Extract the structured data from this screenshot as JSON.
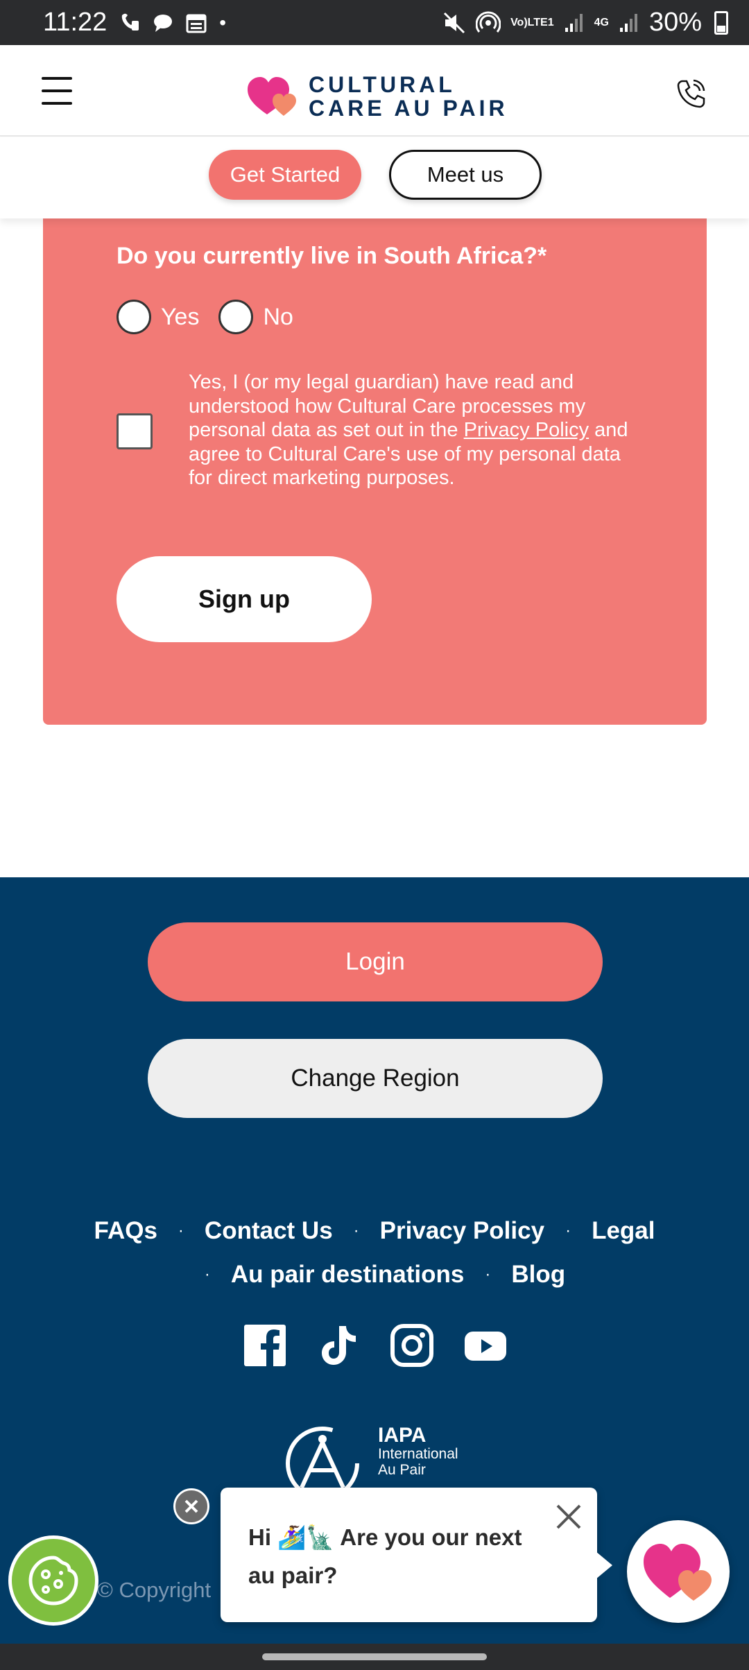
{
  "status_bar": {
    "time": "11:22",
    "dot": "•",
    "network_label_top": "Vo)",
    "network_label_bottom": "LTE1",
    "data_type": "4G",
    "battery": "30%"
  },
  "header": {
    "logo_line1": "CULTURAL",
    "logo_line2": "CARE AU PAIR"
  },
  "cta": {
    "get_started": "Get Started",
    "meet_us": "Meet us"
  },
  "form": {
    "question": "Do you currently live in South Africa?*",
    "option_yes": "Yes",
    "option_no": "No",
    "consent_before_link": "Yes, I (or my legal guardian) have read and understood how Cultural Care processes my personal data as set out in the ",
    "privacy_link": "Privacy Policy",
    "consent_after_link": " and agree to Cultural Care's use of my personal data for direct marketing purposes.",
    "sign_up": "Sign up"
  },
  "footer": {
    "login": "Login",
    "change_region": "Change Region",
    "links_row1": [
      "FAQs",
      "Contact Us",
      "Privacy Policy",
      "Legal"
    ],
    "links_row2": [
      "Au pair destinations",
      "Blog"
    ],
    "separator": "·",
    "iapa_title": "IAPA",
    "iapa_line1": "International",
    "iapa_line2": "Au Pair",
    "copyright": "© Copyright"
  },
  "chat": {
    "greeting": "Hi 🏄‍♀️🗽 Are you our next au pair?"
  },
  "colors": {
    "coral": "#f2736f",
    "navy": "#023c66",
    "cookie_green": "#7fbf3f",
    "brand_pink": "#e6338a"
  },
  "icons": {
    "menu": "hamburger-menu-icon",
    "phone": "phone-icon",
    "facebook": "facebook-icon",
    "tiktok": "tiktok-icon",
    "instagram": "instagram-icon",
    "youtube": "youtube-icon",
    "cookie": "cookie-icon",
    "close": "close-icon"
  }
}
